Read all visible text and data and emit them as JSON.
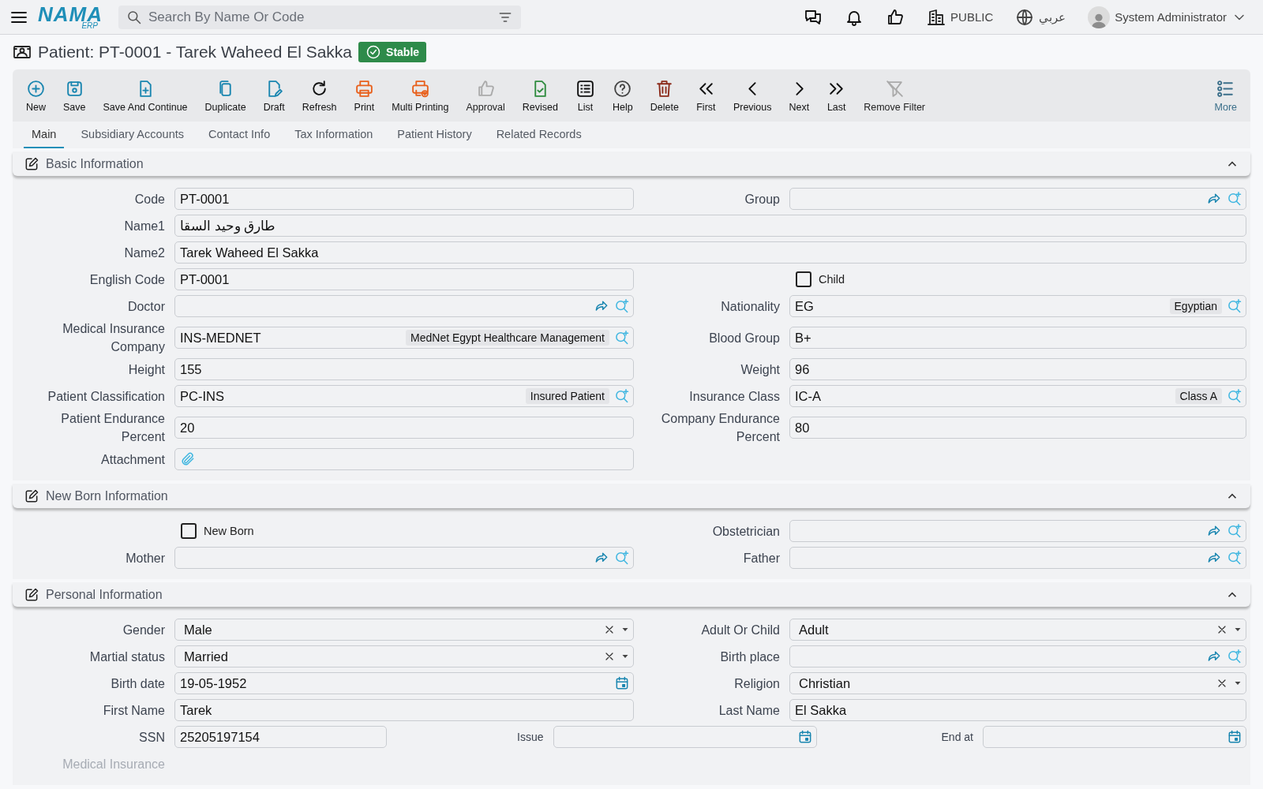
{
  "topbar": {
    "logo": {
      "name": "NAMA",
      "suffix": "ERP"
    },
    "search": {
      "placeholder": "Search By Name Or Code"
    },
    "company": "PUBLIC",
    "language": "عربي",
    "user": "System Administrator"
  },
  "title": {
    "text": "Patient: PT-0001 - Tarek Waheed El Sakka",
    "status": "Stable"
  },
  "toolbar": {
    "items": [
      {
        "kind": "new",
        "label": "New",
        "disabled": false
      },
      {
        "kind": "save",
        "label": "Save",
        "disabled": false
      },
      {
        "kind": "savecontinue",
        "label": "Save And Continue",
        "disabled": false
      },
      {
        "kind": "duplicate",
        "label": "Duplicate",
        "disabled": false
      },
      {
        "kind": "draft",
        "label": "Draft",
        "disabled": false
      },
      {
        "kind": "refresh",
        "label": "Refresh",
        "disabled": false
      },
      {
        "kind": "print",
        "label": "Print",
        "disabled": false
      },
      {
        "kind": "multiprint",
        "label": "Multi Printing",
        "disabled": false
      },
      {
        "kind": "approval",
        "label": "Approval",
        "disabled": true
      },
      {
        "kind": "revised",
        "label": "Revised",
        "disabled": false
      },
      {
        "kind": "list",
        "label": "List",
        "disabled": false
      },
      {
        "kind": "help",
        "label": "Help",
        "disabled": false
      },
      {
        "kind": "delete",
        "label": "Delete",
        "disabled": false
      },
      {
        "kind": "first",
        "label": "First",
        "disabled": false
      },
      {
        "kind": "previous",
        "label": "Previous",
        "disabled": false
      },
      {
        "kind": "next",
        "label": "Next",
        "disabled": false
      },
      {
        "kind": "last",
        "label": "Last",
        "disabled": false
      },
      {
        "kind": "removefilter",
        "label": "Remove Filter",
        "disabled": true
      }
    ],
    "more": "More"
  },
  "tabs": [
    {
      "label": "Main",
      "selected": true
    },
    {
      "label": "Subsidiary Accounts",
      "selected": false
    },
    {
      "label": "Contact Info",
      "selected": false
    },
    {
      "label": "Tax Information",
      "selected": false
    },
    {
      "label": "Patient History",
      "selected": false
    },
    {
      "label": "Related Records",
      "selected": false
    }
  ],
  "sections": [
    {
      "title": "Basic Information",
      "expanded": true,
      "rows": [
        {
          "fields": [
            {
              "kind": "text",
              "label": "Code",
              "value": "PT-0001"
            },
            {
              "kind": "lookup",
              "label": "Group",
              "link": true
            }
          ]
        },
        {
          "fields": [
            {
              "kind": "wide",
              "label": "Name1",
              "value": "طارق وحيد السقا"
            }
          ]
        },
        {
          "fields": [
            {
              "kind": "wide",
              "label": "Name2",
              "value": "Tarek Waheed El Sakka"
            }
          ]
        },
        {
          "fields": [
            {
              "kind": "text",
              "label": "English Code",
              "value": "PT-0001"
            },
            {
              "kind": "check",
              "label": "Child",
              "checked": false
            }
          ]
        },
        {
          "fields": [
            {
              "kind": "lookup",
              "label": "Doctor",
              "link": true
            },
            {
              "kind": "lookup",
              "label": "Nationality",
              "value": "EG",
              "description": "Egyptian",
              "link": false
            }
          ]
        },
        {
          "fields": [
            {
              "kind": "lookup",
              "label": "Medical Insurance Company",
              "value": "INS-MEDNET",
              "description": "MedNet Egypt Healthcare Management",
              "link": false
            },
            {
              "kind": "text",
              "label": "Blood Group",
              "value": "B+"
            }
          ]
        },
        {
          "fields": [
            {
              "kind": "text",
              "label": "Height",
              "value": "155"
            },
            {
              "kind": "text",
              "label": "Weight",
              "value": "96"
            }
          ]
        },
        {
          "fields": [
            {
              "kind": "lookup",
              "label": "Patient Classification",
              "value": "PC-INS",
              "description": "Insured Patient",
              "link": false
            },
            {
              "kind": "lookup",
              "label": "Insurance Class",
              "value": "IC-A",
              "description": "Class A",
              "link": false
            }
          ]
        },
        {
          "fields": [
            {
              "kind": "text",
              "label": "Patient Endurance Percent",
              "value": "20"
            },
            {
              "kind": "text",
              "label": "Company Endurance Percent",
              "value": "80"
            }
          ]
        },
        {
          "fields": [
            {
              "kind": "attach",
              "label": "Attachment"
            }
          ]
        }
      ]
    },
    {
      "title": "New Born Information",
      "expanded": true,
      "rows": [
        {
          "fields": [
            {
              "kind": "check",
              "label": "New Born",
              "checked": false
            },
            {
              "kind": "lookup",
              "label": "Obstetrician",
              "link": true
            }
          ]
        },
        {
          "fields": [
            {
              "kind": "lookup",
              "label": "Mother",
              "link": true
            },
            {
              "kind": "lookup",
              "label": "Father",
              "link": true
            }
          ]
        }
      ]
    },
    {
      "title": "Personal Information",
      "expanded": true,
      "rows": [
        {
          "fields": [
            {
              "kind": "select",
              "label": "Gender",
              "value": "Male"
            },
            {
              "kind": "select",
              "label": "Adult Or Child",
              "value": "Adult"
            }
          ]
        },
        {
          "fields": [
            {
              "kind": "select",
              "label": "Martial status",
              "value": "Married"
            },
            {
              "kind": "lookup",
              "label": "Birth place",
              "link": true
            }
          ]
        },
        {
          "fields": [
            {
              "kind": "date",
              "label": "Birth date",
              "value": "19-05-1952"
            },
            {
              "kind": "select",
              "label": "Religion",
              "value": "Christian"
            }
          ]
        },
        {
          "fields": [
            {
              "kind": "text",
              "label": "First Name",
              "value": "Tarek"
            },
            {
              "kind": "text",
              "label": "Last Name",
              "value": "El Sakka"
            }
          ]
        },
        {
          "fields": [
            {
              "kind": "text",
              "label": "SSN",
              "value": "25205197154"
            },
            {
              "kind": "date",
              "label": "Issue"
            },
            {
              "kind": "date",
              "label": "End at"
            }
          ]
        },
        {
          "fields": [
            {
              "kind": "caption",
              "label": "Medical Insurance"
            }
          ]
        }
      ]
    }
  ]
}
